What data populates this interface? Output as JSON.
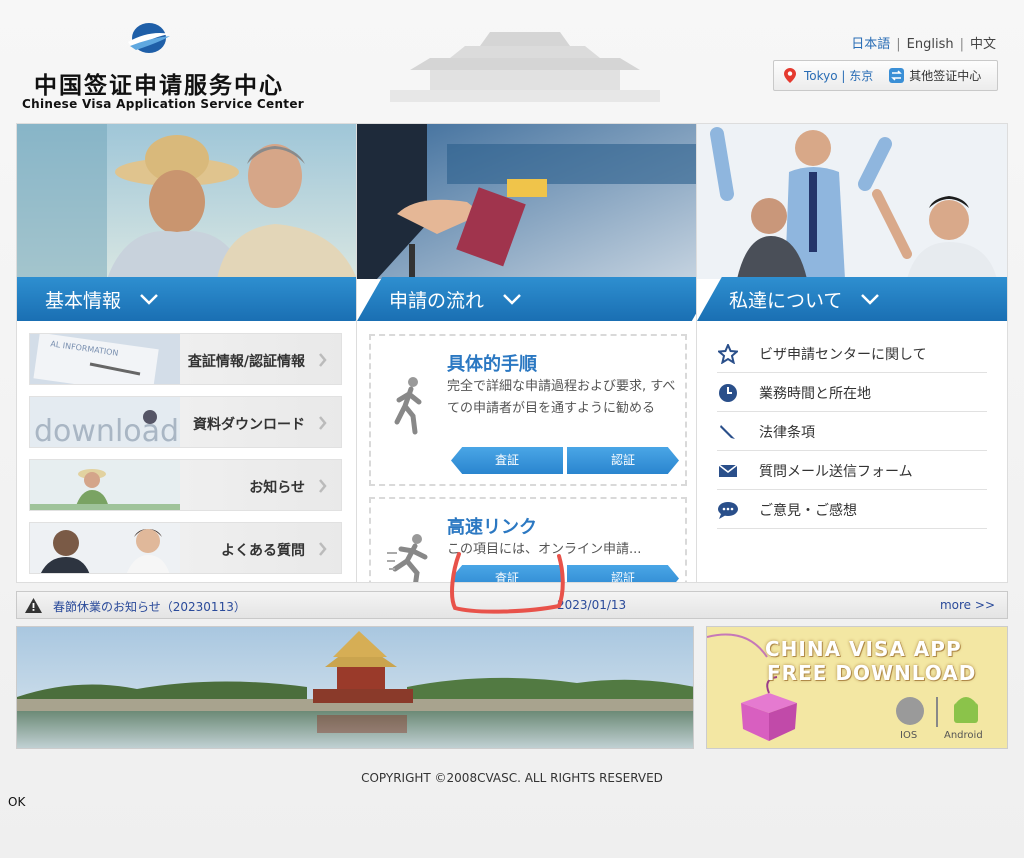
{
  "header": {
    "logo_cn": "中国签证申请服务中心",
    "logo_en": "Chinese Visa Application Service Center",
    "languages": [
      "日本語",
      "English",
      "中文"
    ],
    "location": "Tokyo | 东京",
    "other_centers": "其他签证中心"
  },
  "panels": [
    {
      "title": "基本情報"
    },
    {
      "title": "申請の流れ"
    },
    {
      "title": "私達について"
    }
  ],
  "info_tiles": [
    {
      "label": "査証情報/認証情報",
      "image_text": "AL INFORMATION"
    },
    {
      "label": "資料ダウンロード",
      "image_text": "download"
    },
    {
      "label": "お知らせ"
    },
    {
      "label": "よくある質問"
    }
  ],
  "process": [
    {
      "title": "具体的手順",
      "desc": "完全で詳細な申請過程および要求, すべての申請者が目を通すように勧める",
      "btn_left": "査証",
      "btn_right": "認証"
    },
    {
      "title": "高速リンク",
      "desc": "この項目には、オンライン申請...",
      "btn_left": "査証",
      "btn_right": "認証"
    }
  ],
  "about_items": [
    {
      "label": "ビザ申請センターに関して",
      "icon": "star-icon"
    },
    {
      "label": "業務時間と所在地",
      "icon": "clock-icon"
    },
    {
      "label": "法律条項",
      "icon": "pen-icon"
    },
    {
      "label": "質問メール送信フォーム",
      "icon": "envelope-icon"
    },
    {
      "label": "ご意見・ご感想",
      "icon": "chat-icon"
    }
  ],
  "news": {
    "text": "春節休業のお知らせ（20230113）",
    "date": "2023/01/13",
    "more": "more >>"
  },
  "app_banner": {
    "line1": "CHINA VISA  APP",
    "line2": "FREE DOWNLOAD",
    "ios": "IOS",
    "android": "Android"
  },
  "footer": {
    "copyright": "COPYRIGHT ©2008CVASC. ALL RIGHTS RESERVED",
    "ok": "OK"
  },
  "colors": {
    "accent": "#1f7cc4",
    "link": "#2a6db5",
    "annotation": "#e8524a"
  }
}
